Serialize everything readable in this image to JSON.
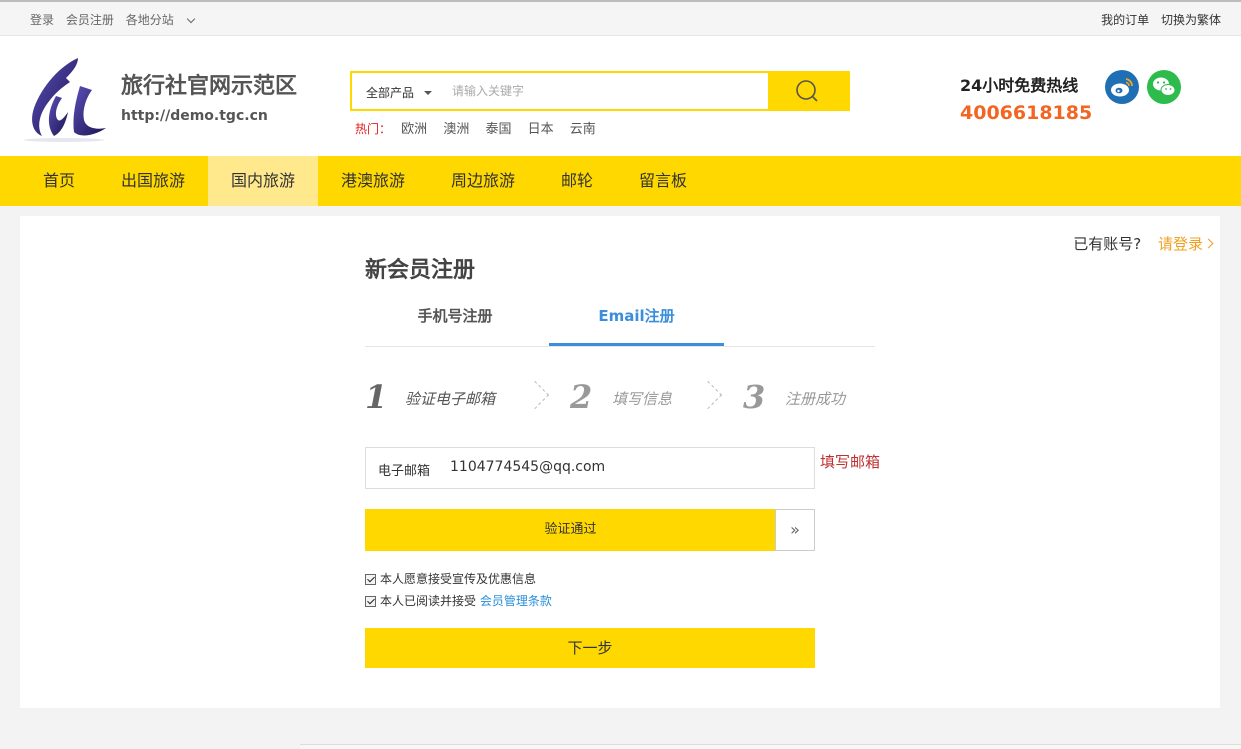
{
  "topbar": {
    "login": "登录",
    "register": "会员注册",
    "sites": "各地分站",
    "orders": "我的订单",
    "traditional": "切换为繁体"
  },
  "header": {
    "site_title": "旅行社官网示范区",
    "site_url": "http://demo.tgc.cn",
    "hotline_label": "24小时免费热线",
    "phone": "4006618185"
  },
  "search": {
    "category": "全部产品",
    "placeholder": "请输入关键字",
    "hot_label": "热门：",
    "hot_keywords": [
      "欧洲",
      "澳洲",
      "泰国",
      "日本",
      "云南"
    ]
  },
  "nav": {
    "items": [
      "首页",
      "出国旅游",
      "国内旅游",
      "港澳旅游",
      "周边旅游",
      "邮轮",
      "留言板"
    ],
    "active_index": 2
  },
  "account": {
    "have_account": "已有账号?",
    "login_link": "请登录"
  },
  "register": {
    "title": "新会员注册",
    "tabs": [
      "手机号注册",
      "Email注册"
    ],
    "active_tab": 1,
    "steps": [
      {
        "num": "1",
        "label": "验证电子邮箱"
      },
      {
        "num": "2",
        "label": "填写信息"
      },
      {
        "num": "3",
        "label": "注册成功"
      }
    ],
    "email_label": "电子邮箱",
    "email_value": "1104774545@qq.com",
    "email_hint": "填写邮箱",
    "verify_label": "验证通过",
    "verify_handle": "»",
    "check_promo": "本人愿意接受宣传及优惠信息",
    "check_terms": "本人已阅读并接受",
    "terms_link": "会员管理条款",
    "next_button": "下一步"
  },
  "colors": {
    "accent_yellow": "#ffd800",
    "nav_active": "#ffe98c",
    "tab_active_blue": "#3a8edb",
    "phone_orange": "#f26522",
    "hint_red": "#c03030"
  },
  "icons": [
    "chevron-down-icon",
    "search-icon",
    "weibo-icon",
    "wechat-icon",
    "chevron-right-icon",
    "double-chevron-right-icon",
    "checkbox-checked-icon"
  ]
}
